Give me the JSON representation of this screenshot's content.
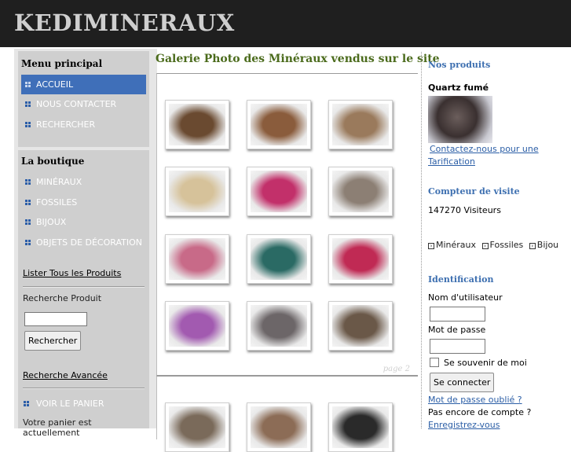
{
  "site": {
    "title": "KEDIMINERAUX"
  },
  "left": {
    "menu_title": "Menu principal",
    "menu": [
      {
        "label": "ACCUEIL"
      },
      {
        "label": "NOUS CONTACTER"
      },
      {
        "label": "RECHERCHER"
      }
    ],
    "shop_title": "La boutique",
    "shop": [
      {
        "label": "MINÉRAUX"
      },
      {
        "label": "FOSSILES"
      },
      {
        "label": "BIJOUX"
      },
      {
        "label": "OBJETS DE DÉCORATION"
      }
    ],
    "list_all": "Lister Tous les Produits",
    "search_label": "Recherche Produit",
    "search_value": "",
    "search_button": "Rechercher",
    "advanced": "Recherche Avancée",
    "cart_link": "VOIR LE PANIER",
    "cart_status": "Votre panier est actuellement"
  },
  "main": {
    "title": "Galerie Photo des Minéraux vendus sur le site",
    "page_label": "page 2",
    "thumbs": [
      {
        "name": "smoky-quartz-photo",
        "color": "#6a4a30"
      },
      {
        "name": "smoky-quartz-photo",
        "color": "#8a5c3c"
      },
      {
        "name": "mineral-photo",
        "color": "#9a7a5c"
      },
      {
        "name": "mineral-photo",
        "color": "#d6c29a"
      },
      {
        "name": "mineral-photo",
        "color": "#c2306a"
      },
      {
        "name": "mineral-photo",
        "color": "#8c7f74"
      },
      {
        "name": "mineral-photo",
        "color": "#c86a88"
      },
      {
        "name": "mineral-photo",
        "color": "#2a6a64"
      },
      {
        "name": "mineral-photo",
        "color": "#c02a54"
      },
      {
        "name": "mineral-photo",
        "color": "#a25ab0"
      },
      {
        "name": "mineral-photo",
        "color": "#6c6668"
      },
      {
        "name": "mineral-photo",
        "color": "#6a5848"
      },
      {
        "name": "mineral-photo",
        "color": "#7a6a5a"
      },
      {
        "name": "mineral-photo",
        "color": "#8c6c56"
      },
      {
        "name": "mineral-photo",
        "color": "#2a2a2a"
      }
    ]
  },
  "right": {
    "products_title": "Nos produits",
    "product_name": "Quartz fumé",
    "product_link_1": "Contactez-nous pour une",
    "product_link_2": "Tarification",
    "counter_title": "Compteur de visite",
    "counter_value": "147270 Visiteurs",
    "categories": [
      {
        "label": "Minéraux"
      },
      {
        "label": "Fossiles"
      },
      {
        "label": "Bijou"
      }
    ],
    "login_title": "Identification",
    "username_label": "Nom d'utilisateur",
    "username_value": "",
    "password_label": "Mot de passe",
    "password_value": "",
    "remember_label": "Se souvenir de moi",
    "login_button": "Se connecter",
    "forgot_link": "Mot de passe oublié ?",
    "no_account": "Pas encore de compte ?",
    "register_link": "Enregistrez-vous"
  }
}
